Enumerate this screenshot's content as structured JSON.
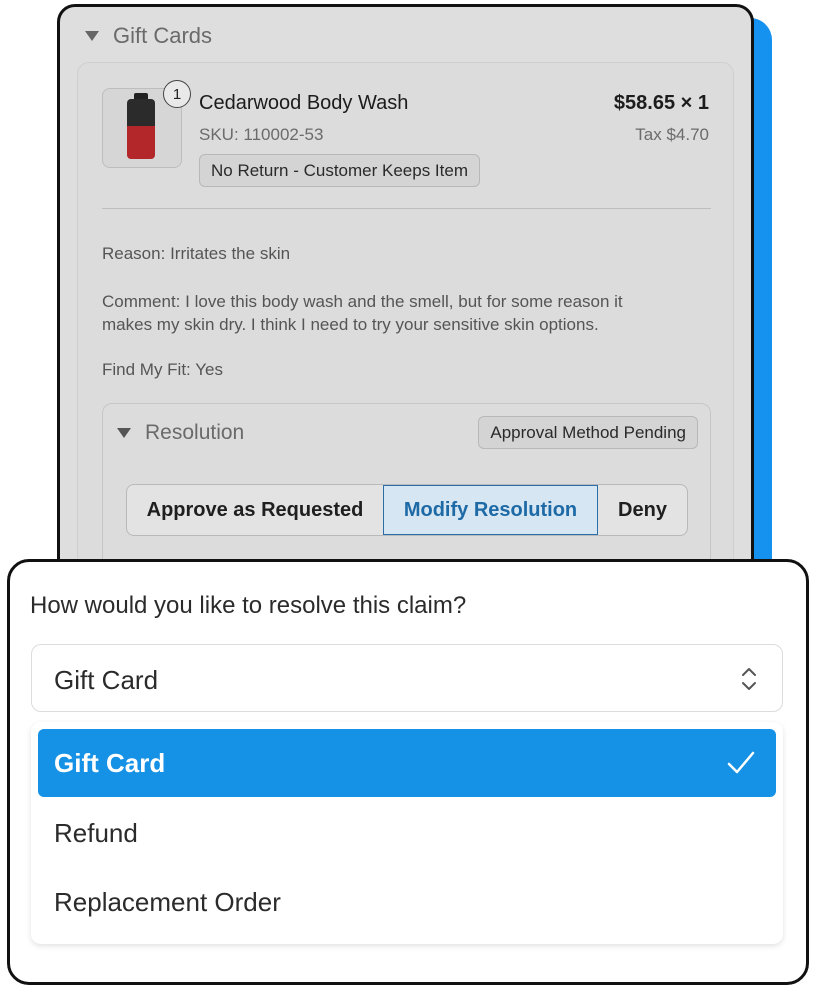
{
  "section": {
    "title": "Gift Cards"
  },
  "item": {
    "quantity_badge": "1",
    "name": "Cedarwood Body Wash",
    "sku": "SKU: 110002-53",
    "return_type": "No Return - Customer Keeps Item",
    "price": "$58.65 × 1",
    "tax": "Tax $4.70"
  },
  "details": {
    "reason_label": "Reason:",
    "reason_value": "Irritates the skin",
    "comment_label": "Comment:",
    "comment_line1": "I love this body wash and the smell, but for some reason it",
    "comment_line2": "makes my skin dry. I think I need to try your sensitive skin options.",
    "fit_label": "Find My Fit:",
    "fit_value": "Yes"
  },
  "resolution": {
    "title": "Resolution",
    "status": "Approval Method Pending",
    "actions": [
      "Approve as Requested",
      "Modify Resolution",
      "Deny"
    ],
    "selected_action": "Modify Resolution"
  },
  "claim": {
    "question": "How would you like to resolve this claim?",
    "selected_value": "Gift Card",
    "options": [
      "Gift Card",
      "Refund",
      "Replacement Order"
    ]
  },
  "colors": {
    "accent": "#1592e6",
    "selected_segment_text": "#1e6aa6"
  },
  "icons": {
    "section_toggle": "triangle-down-icon",
    "select_chevron": "up-down-chevron-icon",
    "selected_check": "checkmark-icon"
  }
}
